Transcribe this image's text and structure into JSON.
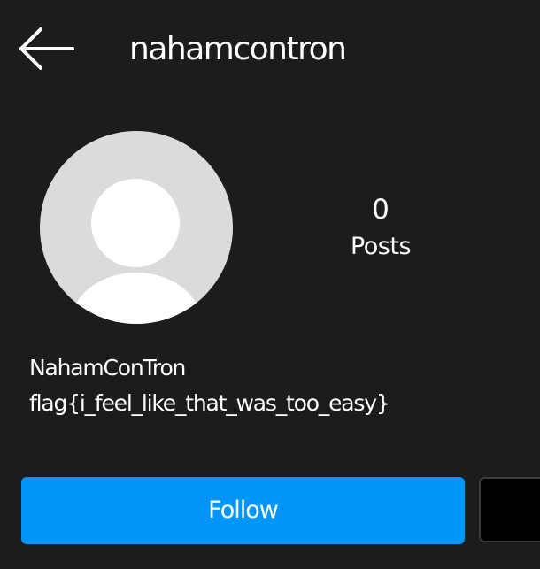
{
  "header": {
    "back_icon": "arrow-left-icon",
    "username": "nahamcontron"
  },
  "profile": {
    "avatar_icon": "default-avatar-icon",
    "posts_count": "0",
    "posts_label": "Posts",
    "display_name": "NahamConTron",
    "bio": "flag{i_feel_like_that_was_too_easy}"
  },
  "actions": {
    "follow_label": "Follow",
    "message_label": ""
  },
  "colors": {
    "background": "#1c1c1c",
    "accent": "#0095f6",
    "avatar_bg": "#dbdbdb"
  }
}
